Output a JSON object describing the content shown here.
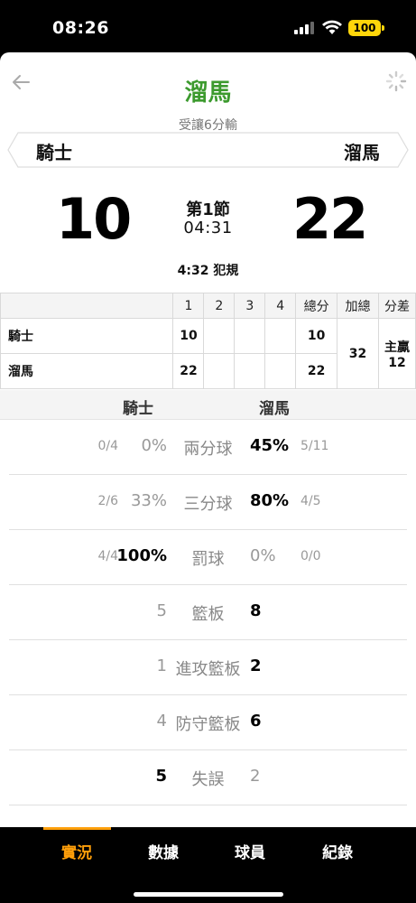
{
  "status_bar": {
    "time": "08:26",
    "battery": "100"
  },
  "header": {
    "title": "溜馬",
    "subtitle": "受讓6分輸",
    "team_left": "騎士",
    "team_right": "溜馬"
  },
  "scoreboard": {
    "score_left": "10",
    "score_right": "22",
    "period": "第1節",
    "clock": "04:31",
    "event": "4:32 犯規"
  },
  "box_score": {
    "headers": [
      "1",
      "2",
      "3",
      "4",
      "總分",
      "加總",
      "分差"
    ],
    "rows": [
      {
        "team": "騎士",
        "q1": "10",
        "q2": "",
        "q3": "",
        "q4": "",
        "total": "10"
      },
      {
        "team": "溜馬",
        "q1": "22",
        "q2": "",
        "q3": "",
        "q4": "",
        "total": "22"
      }
    ],
    "combined_total": "32",
    "spread_label": "主贏",
    "spread_value": "12"
  },
  "stats_header": {
    "left": "騎士",
    "right": "溜馬"
  },
  "stats": [
    {
      "label": "兩分球",
      "left_sub": "0/4",
      "left": "0%",
      "right": "45%",
      "right_sub": "5/11",
      "leader": "right"
    },
    {
      "label": "三分球",
      "left_sub": "2/6",
      "left": "33%",
      "right": "80%",
      "right_sub": "4/5",
      "leader": "right"
    },
    {
      "label": "罰球",
      "left_sub": "4/4",
      "left": "100%",
      "right": "0%",
      "right_sub": "0/0",
      "leader": "left"
    },
    {
      "label": "籃板",
      "left_sub": "",
      "left": "5",
      "right": "8",
      "right_sub": "",
      "leader": "right"
    },
    {
      "label": "進攻籃板",
      "left_sub": "",
      "left": "1",
      "right": "2",
      "right_sub": "",
      "leader": "right"
    },
    {
      "label": "防守籃板",
      "left_sub": "",
      "left": "4",
      "right": "6",
      "right_sub": "",
      "leader": "right"
    },
    {
      "label": "失誤",
      "left_sub": "",
      "left": "5",
      "right": "2",
      "right_sub": "",
      "leader": "left"
    }
  ],
  "tabs": [
    {
      "label": "實況",
      "active": true
    },
    {
      "label": "數據",
      "active": false
    },
    {
      "label": "球員",
      "active": false
    },
    {
      "label": "紀錄",
      "active": false
    }
  ],
  "colors": {
    "title_green": "#3c9a2e",
    "accent_orange": "#ff9f0a",
    "battery_yellow": "#ffd60a"
  }
}
